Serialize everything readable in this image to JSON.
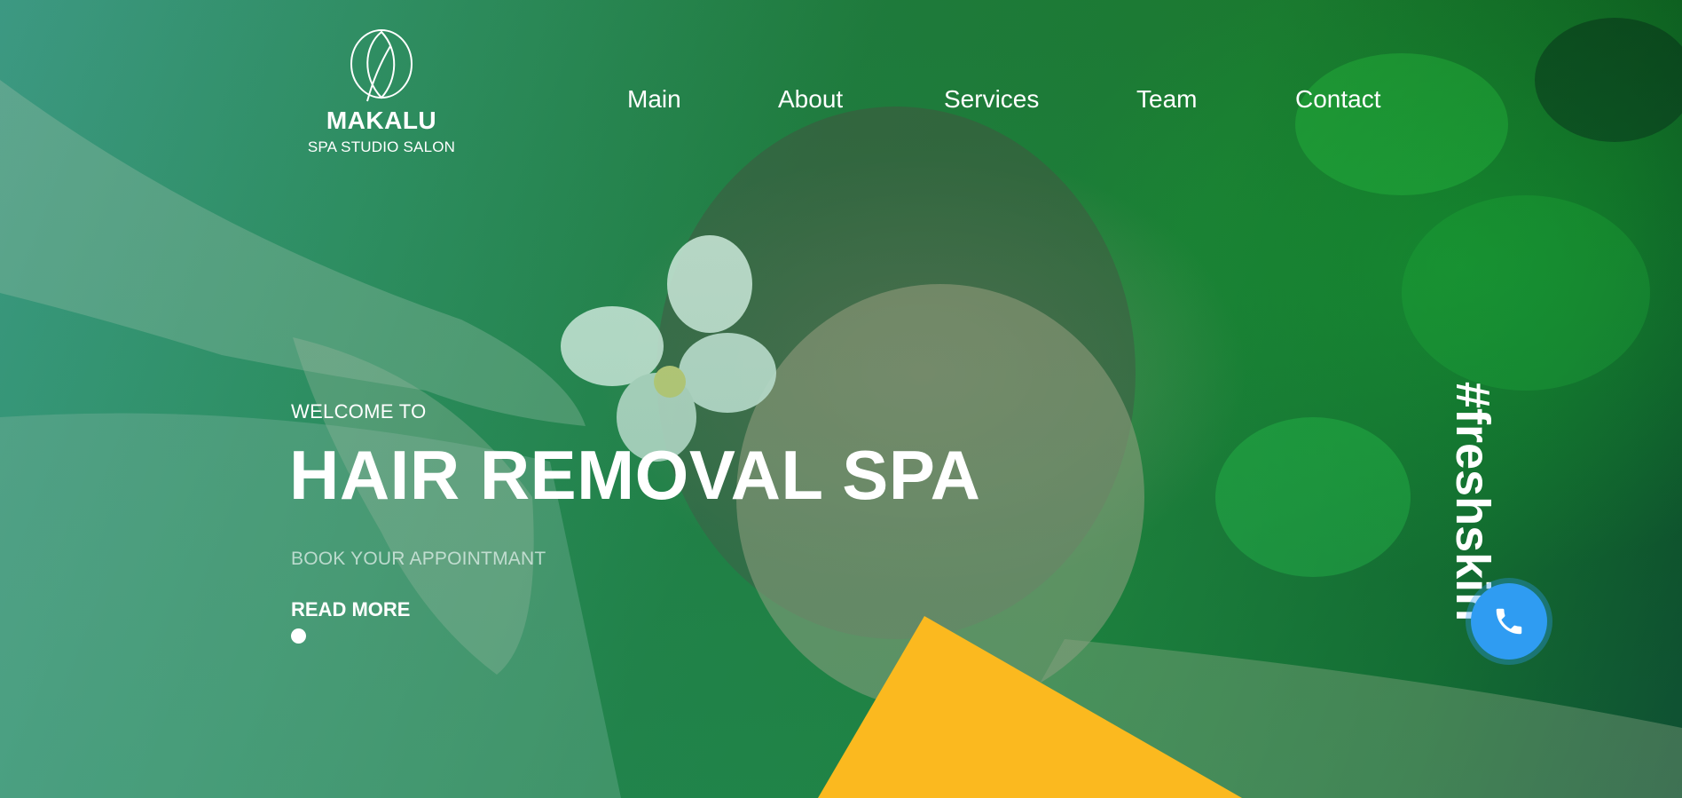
{
  "brand": {
    "name": "MAKALU",
    "tagline": "SPA STUDIO SALON",
    "logo_icon": "leaf-logo-icon"
  },
  "nav": {
    "items": [
      {
        "label": "Main"
      },
      {
        "label": "About"
      },
      {
        "label": "Services"
      },
      {
        "label": "Team"
      },
      {
        "label": "Contact"
      }
    ]
  },
  "hero": {
    "welcome": "WELCOME TO",
    "headline": "HAIR REMOVAL SPA",
    "subline": "BOOK YOUR APPOINTMANT",
    "read_more": "READ MORE",
    "hashtag": "#freshskin"
  },
  "call_button": {
    "icon": "phone-icon"
  },
  "colors": {
    "accent_yellow": "#fbb91f",
    "call_blue": "#2f9cf2",
    "text_white": "#ffffff",
    "hero_green": "#1f7a3a"
  }
}
